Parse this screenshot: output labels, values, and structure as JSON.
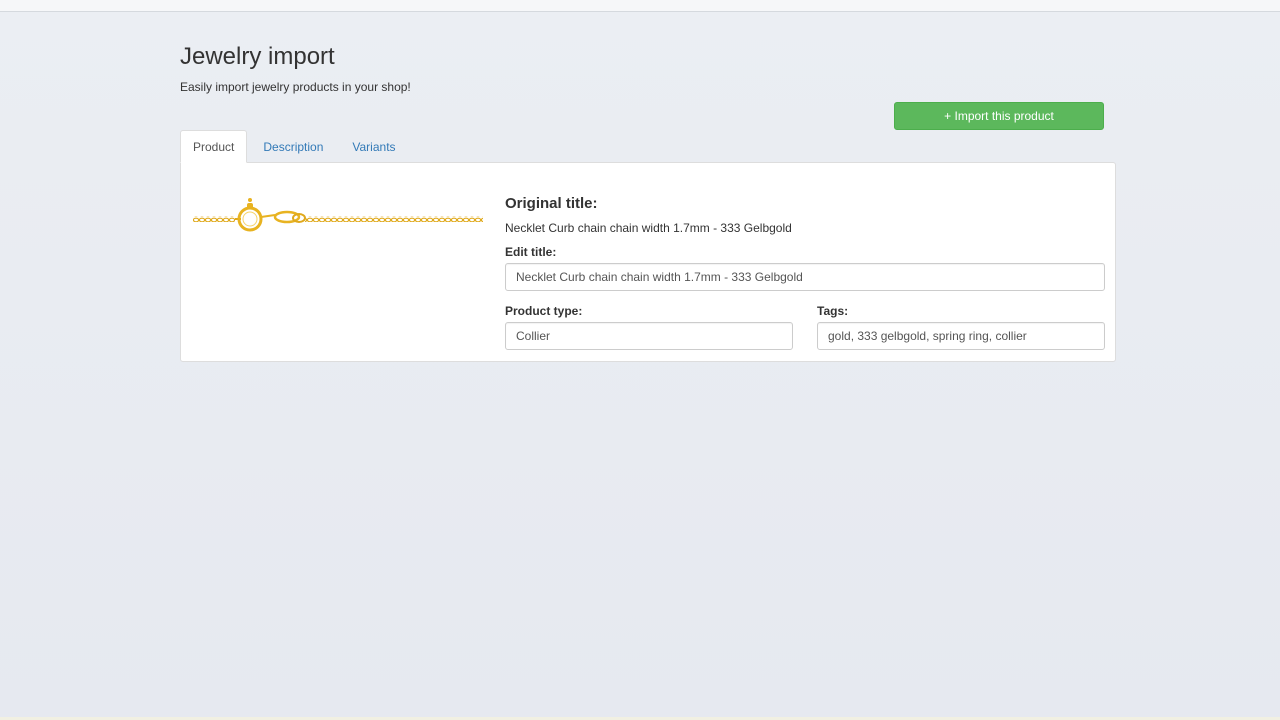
{
  "header": {
    "title": "Jewelry import",
    "subtitle": "Easily import jewelry products in your shop!"
  },
  "actions": {
    "import_label": "+ Import this product"
  },
  "tabs": [
    {
      "label": "Product",
      "active": true
    },
    {
      "label": "Description",
      "active": false
    },
    {
      "label": "Variants",
      "active": false
    }
  ],
  "product": {
    "image_icon": "gold-chain-necklace",
    "original_title_heading": "Original title:",
    "original_title": "Necklet Curb chain chain width 1.7mm - 333 Gelbgold",
    "edit_title_label": "Edit title:",
    "edit_title_value": "Necklet Curb chain chain width 1.7mm - 333 Gelbgold",
    "product_type_label": "Product type:",
    "product_type_value": "Collier",
    "tags_label": "Tags:",
    "tags_value": "gold, 333 gelbgold, spring ring, collier"
  },
  "colors": {
    "accent_green": "#5cb85c",
    "link_blue": "#337ab7",
    "gold": "#e8b321"
  }
}
